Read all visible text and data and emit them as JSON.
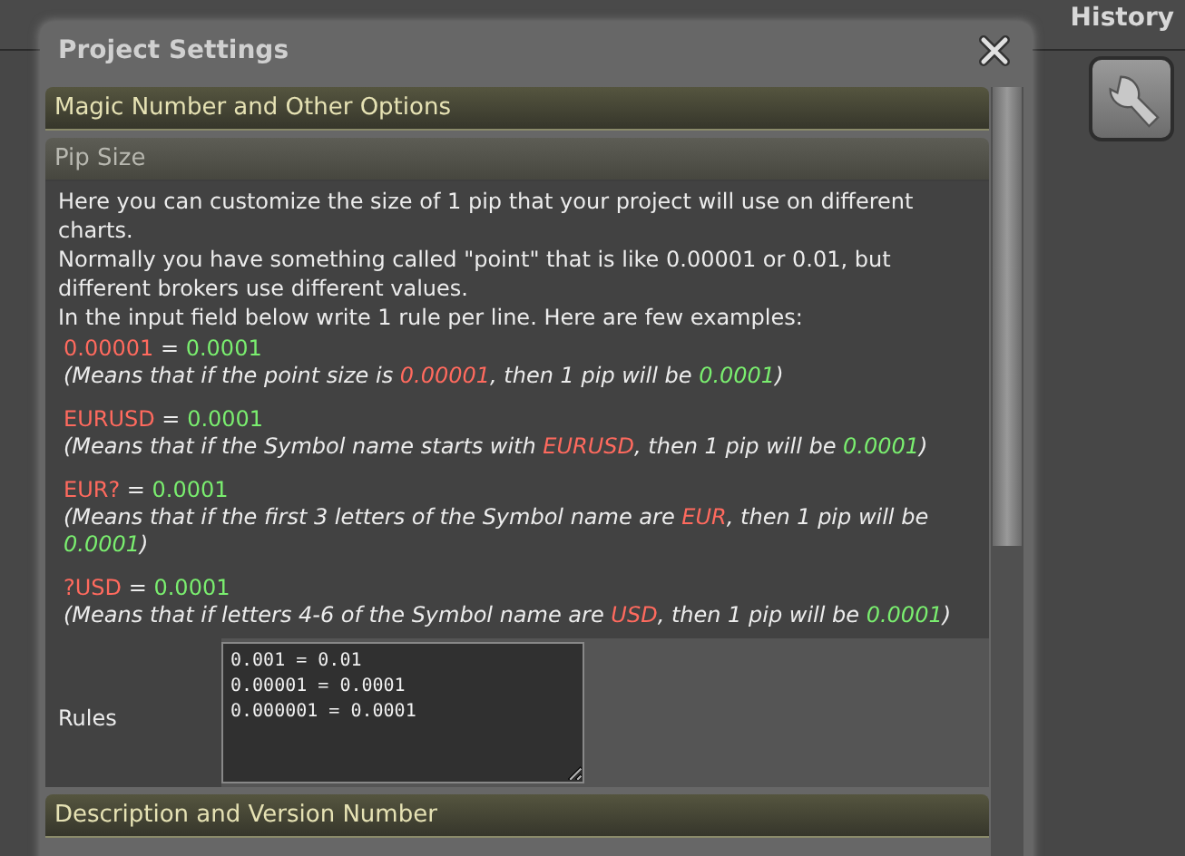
{
  "header": {
    "title": "History"
  },
  "dialog": {
    "title": "Project Settings",
    "sections": [
      {
        "title": "Magic Number and Other Options",
        "expanded": false
      },
      {
        "title": "Pip Size",
        "expanded": true,
        "intro": [
          "Here you can customize the size of 1 pip that your project will use on different charts.",
          "Normally you have something called \"point\" that is like 0.00001 or 0.01, but different brokers use different values.",
          "In the input field below write 1 rule per line. Here are few examples:"
        ],
        "examples": [
          {
            "key": "0.00001",
            "operator": "=",
            "value": "0.0001",
            "explanation": [
              {
                "text": "(Means that if the point size is ",
                "kind": "plain"
              },
              {
                "text": "0.00001",
                "kind": "key"
              },
              {
                "text": ", then 1 pip will be ",
                "kind": "plain"
              },
              {
                "text": "0.0001",
                "kind": "value"
              },
              {
                "text": ")",
                "kind": "plain"
              }
            ]
          },
          {
            "key": "EURUSD",
            "operator": "=",
            "value": "0.0001",
            "explanation": [
              {
                "text": "(Means that if the Symbol name starts with ",
                "kind": "plain"
              },
              {
                "text": "EURUSD",
                "kind": "key"
              },
              {
                "text": ", then 1 pip will be ",
                "kind": "plain"
              },
              {
                "text": "0.0001",
                "kind": "value"
              },
              {
                "text": ")",
                "kind": "plain"
              }
            ]
          },
          {
            "key": "EUR?",
            "operator": "=",
            "value": "0.0001",
            "explanation": [
              {
                "text": "(Means that if the first 3 letters of the Symbol name are ",
                "kind": "plain"
              },
              {
                "text": "EUR",
                "kind": "key"
              },
              {
                "text": ", then 1 pip will be ",
                "kind": "plain"
              },
              {
                "text": "0.0001",
                "kind": "value"
              },
              {
                "text": ")",
                "kind": "plain"
              }
            ]
          },
          {
            "key": "?USD",
            "operator": "=",
            "value": "0.0001",
            "explanation": [
              {
                "text": "(Means that if letters 4-6 of the Symbol name are ",
                "kind": "plain"
              },
              {
                "text": "USD",
                "kind": "key"
              },
              {
                "text": ", then 1 pip will be ",
                "kind": "plain"
              },
              {
                "text": "0.0001",
                "kind": "value"
              },
              {
                "text": ")",
                "kind": "plain"
              }
            ]
          }
        ],
        "rules": {
          "label": "Rules",
          "value": "0.001 = 0.01\n0.00001 = 0.0001\n0.000001 = 0.0001"
        }
      },
      {
        "title": "Description and Version Number",
        "expanded": false
      }
    ]
  }
}
